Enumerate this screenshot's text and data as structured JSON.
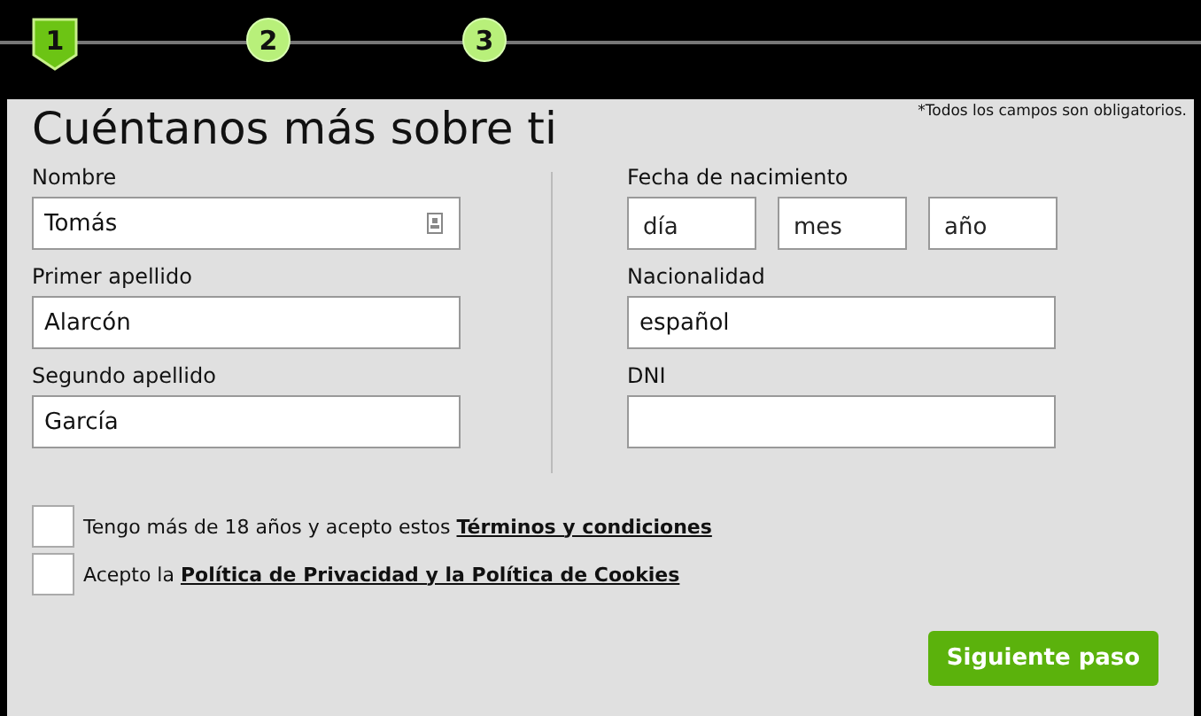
{
  "steps": [
    {
      "label": "1",
      "selected": true
    },
    {
      "label": "2",
      "selected": false
    },
    {
      "label": "3",
      "selected": false
    }
  ],
  "form": {
    "title": "Cuéntanos más sobre ti",
    "required_note": "*Todos los campos son obligatorios.",
    "left_fields": [
      {
        "label": "Nombre",
        "value": "Tomás",
        "autofill_icon": true
      },
      {
        "label": "Primer apellido",
        "value": "Alarcón",
        "autofill_icon": false
      },
      {
        "label": "Segundo apellido",
        "value": "García",
        "autofill_icon": false
      }
    ],
    "birth_date": {
      "label": "Fecha de nacimiento",
      "parts": [
        {
          "placeholder": "día"
        },
        {
          "placeholder": "mes"
        },
        {
          "placeholder": "año"
        }
      ]
    },
    "right_fields": [
      {
        "label": "Nacionalidad",
        "value": "español"
      },
      {
        "label": "DNI"
      }
    ],
    "consents": [
      {
        "text": "Tengo más de 18 años y acepto estos",
        "link": "Términos y condiciones",
        "checked": false
      },
      {
        "text": "Acepto la",
        "link": "Política de Privacidad y la Política de Cookies",
        "checked": false
      }
    ],
    "submit": "Siguiente paso"
  }
}
